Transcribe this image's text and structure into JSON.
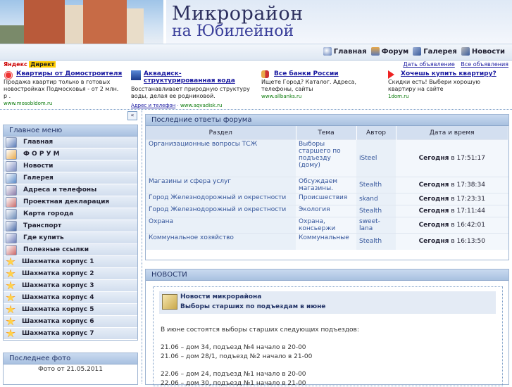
{
  "header": {
    "title_line1": "Микрорайон",
    "title_line2": "на Юбилейной"
  },
  "topnav": {
    "items": [
      {
        "label": "Главная",
        "icon": "home-icon"
      },
      {
        "label": "Форум",
        "icon": "forum-icon"
      },
      {
        "label": "Галерея",
        "icon": "gallery-icon"
      },
      {
        "label": "Новости",
        "icon": "news-icon"
      }
    ]
  },
  "yandex": {
    "brand": "Яндекс",
    "direct": "Директ",
    "links": [
      "Дать объявление",
      "Все объявления"
    ]
  },
  "ads": [
    {
      "title": "Квартиры от Домостроителя",
      "desc": "Продажа квартир только в готовых новостройках Подмосковья - от 2 млн. р .",
      "url": "www.mosobldom.ru"
    },
    {
      "title": "Аквадиск-структурированная вода",
      "desc": "Восстанавливает природную структуру воды, делая ее родниковой.",
      "url": "www.aqvadisk.ru",
      "extra": "Адрес и телефон"
    },
    {
      "title": "Все банки России",
      "desc": "Ищете Город? Каталог. Адреса, телефоны, сайты",
      "url": "www.allbanks.ru"
    },
    {
      "title": "Хочешь купить квартиру?",
      "desc": "Скидки есть! Выбери хорошую квартиру на сайте",
      "url": "1dom.ru"
    }
  ],
  "collapse_btn": "«",
  "main_menu": {
    "title": "Главное меню",
    "items": [
      "Главная",
      "Ф О Р У М",
      "Новости",
      "Галерея",
      "Адреса и телефоны",
      "Проектная декларация",
      "Карта города",
      "Транспорт",
      "Где купить",
      "Полезные ссылки",
      "Шахматка корпус 1",
      "Шахматка корпус 2",
      "Шахматка корпус 3",
      "Шахматка корпус 4",
      "Шахматка корпус 5",
      "Шахматка корпус 6",
      "Шахматка корпус 7"
    ]
  },
  "last_photo": {
    "title": "Последнее фото",
    "caption": "Фото от 21.05.2011"
  },
  "forum": {
    "title": "Последние ответы форума",
    "columns": [
      "Раздел",
      "Тема",
      "Автор",
      "Дата и время"
    ],
    "rows": [
      {
        "section": "Организационные вопросы ТСЖ",
        "topic": "Выборы старшего по подъезду (дому)",
        "author": "iSteel",
        "day": "Сегодня",
        "time": "в 17:51:17"
      },
      {
        "section": "Магазины и сфера услуг",
        "topic": "Обсуждаем магазины.",
        "author": "Stealth",
        "day": "Сегодня",
        "time": "в 17:38:34"
      },
      {
        "section": "Город Железнодорожный и окрестности",
        "topic": "Происшествия",
        "author": "skand",
        "day": "Сегодня",
        "time": "в 17:23:31"
      },
      {
        "section": "Город Железнодорожный и окрестности",
        "topic": "Экология",
        "author": "Stealth",
        "day": "Сегодня",
        "time": "в 17:11:44"
      },
      {
        "section": "Охрана",
        "topic": "Охрана, консьержи",
        "author": "sweet-lana",
        "day": "Сегодня",
        "time": "в 16:42:01"
      },
      {
        "section": "Коммунальное хозяйство",
        "topic": "Коммунальные",
        "author": "Stealth",
        "day": "Сегодня",
        "time": "в 16:13:50"
      }
    ]
  },
  "news": {
    "title": "НОВОСТИ",
    "category": "Новости микрорайона",
    "headline": "Выборы старших по подъездам в июне",
    "lines": [
      "В июне состоятся выборы старших следующих подъездов:",
      "21.06 – дом 34, подъезд №4 начало в 20-00",
      "21.06 – дом 28/1, подъезд №2 начало в 21-00",
      "22.06 – дом 24, подъезд №1 начало в 20-00",
      "22.06 – дом 30, подъезд №1 начало в 21-00"
    ]
  }
}
